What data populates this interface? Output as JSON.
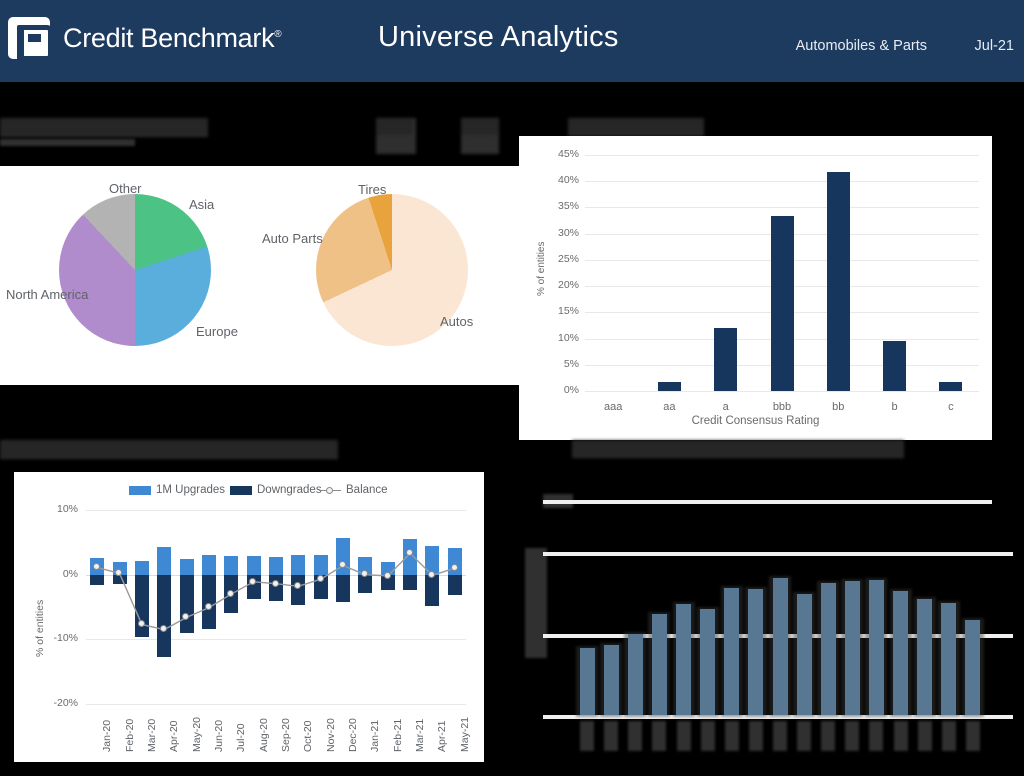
{
  "header": {
    "logo_text": "Credit Benchmark",
    "logo_reg": "®",
    "logo_icon": "cb-logo-icon",
    "title": "Universe Analytics",
    "sector": "Automobiles & Parts",
    "date": "Jul-21",
    "bg_color": "#1d3a5f"
  },
  "obscured": {
    "section_title_left": "████████████████████████",
    "stat_box_1": "████\n████",
    "stat_box_2": "████\n████",
    "section_title_right": "████████████████",
    "section_title_updown": "██████████████████████████████████████",
    "section_title_bottomright": "████████████████████████████████████████"
  },
  "chart_data": [
    {
      "id": "region-pie",
      "type": "pie",
      "title": "",
      "legend_position": "outside-labels",
      "slices": [
        {
          "label": "Asia",
          "value": 20,
          "color": "#4cc285"
        },
        {
          "label": "Europe",
          "value": 30,
          "color": "#5aaedb"
        },
        {
          "label": "North America",
          "value": 38,
          "color": "#b18ccc"
        },
        {
          "label": "Other",
          "value": 12,
          "color": "#b3b3b3"
        }
      ]
    },
    {
      "id": "subsector-pie",
      "type": "pie",
      "title": "",
      "legend_position": "outside-labels",
      "slices": [
        {
          "label": "Autos",
          "value": 68,
          "color": "#fae6d2"
        },
        {
          "label": "Auto Parts",
          "value": 27,
          "color": "#f0c186"
        },
        {
          "label": "Tires",
          "value": 5,
          "color": "#e8a33d"
        }
      ]
    },
    {
      "id": "credit-consensus-rating",
      "type": "bar",
      "title": "",
      "xlabel": "Credit Consensus Rating",
      "ylabel": "% of entities",
      "categories": [
        "aaa",
        "aa",
        "a",
        "bbb",
        "bb",
        "b",
        "c"
      ],
      "values": [
        0,
        1.7,
        12.0,
        33.3,
        41.8,
        9.5,
        1.8
      ],
      "ytick_labels": [
        "0%",
        "5%",
        "10%",
        "15%",
        "20%",
        "25%",
        "30%",
        "35%",
        "40%",
        "45%"
      ],
      "ylim": [
        0,
        45
      ],
      "grid": true,
      "bar_color": "#17365d"
    },
    {
      "id": "upgrades-downgrades",
      "type": "bar",
      "title": "",
      "xlabel": "",
      "ylabel": "% of entities",
      "ylim": [
        -20,
        10
      ],
      "ytick_labels": [
        "10%",
        "0%",
        "-10%",
        "-20%"
      ],
      "grid": true,
      "legend": [
        "1M Upgrades",
        "Downgrades",
        "Balance"
      ],
      "legend_colors": [
        "#3f88d4",
        "#17365d",
        "#8a8a8a"
      ],
      "categories": [
        "Jan-20",
        "Feb-20",
        "Mar-20",
        "Apr-20",
        "May-20",
        "Jun-20",
        "Jul-20",
        "Aug-20",
        "Sep-20",
        "Oct-20",
        "Nov-20",
        "Dec-20",
        "Jan-21",
        "Feb-21",
        "Mar-21",
        "Apr-21",
        "May-21"
      ],
      "series": [
        {
          "name": "1M Upgrades",
          "values": [
            2.6,
            1.9,
            2.1,
            4.3,
            2.4,
            3.1,
            2.9,
            2.9,
            2.8,
            3.1,
            3.1,
            5.6,
            2.7,
            2.0,
            5.5,
            4.5,
            4.2
          ]
        },
        {
          "name": "Downgrades",
          "values": [
            -1.6,
            -1.5,
            -9.6,
            -12.7,
            -9.0,
            -8.4,
            -5.9,
            -3.7,
            -4.1,
            -4.7,
            -3.7,
            -4.2,
            -2.8,
            -2.3,
            -2.3,
            -4.8,
            -3.2
          ]
        },
        {
          "name": "Balance",
          "values": [
            1.1,
            0.2,
            -7.7,
            -8.5,
            -6.6,
            -5.1,
            -3.0,
            -1.1,
            -1.4,
            -1.8,
            -0.7,
            1.4,
            0.0,
            -0.2,
            3.3,
            -0.1,
            1.0
          ]
        }
      ]
    },
    {
      "id": "obscured-bottom-right",
      "type": "bar",
      "title": "",
      "xlabel": "",
      "ylabel": "",
      "grid": true,
      "bar_color": "#6fa8dc",
      "categories": [
        "█",
        "█",
        "█",
        "█",
        "█",
        "█",
        "█",
        "█",
        "█",
        "█",
        "█",
        "█",
        "█",
        "█",
        "█",
        "█",
        "█"
      ],
      "values": [
        41,
        43,
        50,
        62,
        68,
        65,
        78,
        77,
        84,
        74,
        81,
        82,
        83,
        76,
        71,
        69,
        58
      ],
      "ylim": [
        0,
        100
      ]
    }
  ]
}
